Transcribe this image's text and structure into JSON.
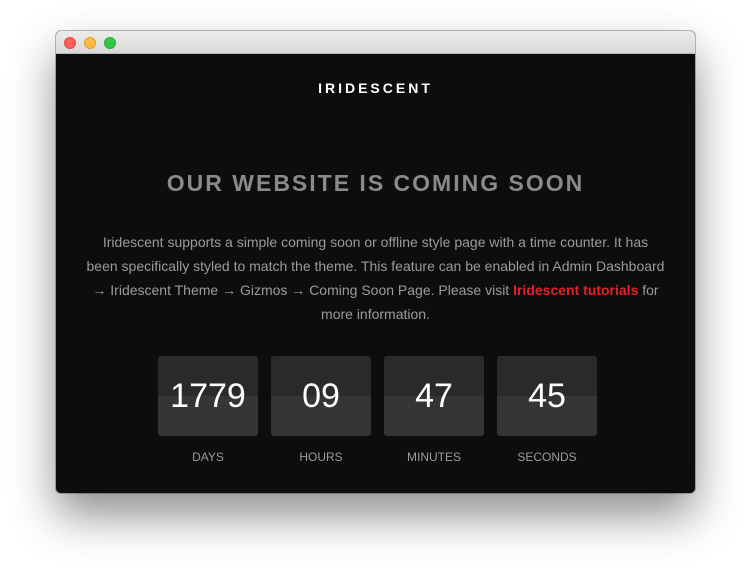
{
  "window": {
    "controls": [
      "close",
      "minimize",
      "maximize"
    ]
  },
  "page": {
    "brand": "IRIDESCENT",
    "headline": "OUR WEBSITE IS COMING SOON",
    "description": {
      "text": "Iridescent supports a simple coming soon or offline style page with a time counter. It has been specifically styled to match the theme. This feature can be enabled in Admin Dashboard → Iridescent Theme → Gizmos → Coming Soon Page. Please visit ",
      "link": "Iridescent tutorials",
      "suffix": " for more information."
    }
  },
  "countdown": [
    {
      "value": "1779",
      "label": "DAYS"
    },
    {
      "value": "09",
      "label": "HOURS"
    },
    {
      "value": "47",
      "label": "MINUTES"
    },
    {
      "value": "45",
      "label": "SECONDS"
    }
  ],
  "colors": {
    "background": "#0d0d0d",
    "accent": "#e2222b",
    "headline": "#8a8a8a",
    "text": "#9b9b9b"
  }
}
